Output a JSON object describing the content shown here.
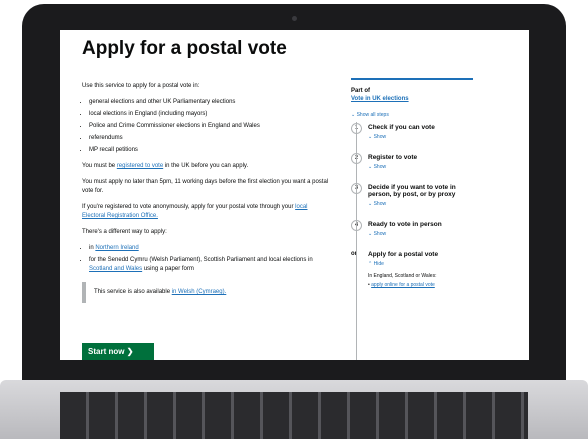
{
  "page": {
    "title": "Apply for a postal vote",
    "intro": "Use this service to apply for a postal vote in:",
    "bullets": [
      "general elections and other UK Parliamentary elections",
      "local elections in England (including mayors)",
      "Police and Crime Commissioner elections in England and Wales",
      "referendums",
      "MP recall petitions"
    ],
    "registered_before": "You must be",
    "registered_link": "registered to vote",
    "registered_after": "in the UK before you can apply.",
    "deadline": "You must apply no later than 5pm, 11 working days before the first election you want a postal vote for.",
    "anon_text": "If you're registered to vote anonymously, apply for your postal vote through your",
    "anon_link": "local Electoral Registration Office.",
    "different_way": "There's a different way to apply:",
    "diff_item1_before": "in",
    "diff_item1_link": "Northern Ireland",
    "diff_item2_before": "for the Senedd Cymru (Welsh Parliament), Scottish Parliament and local elections in",
    "diff_item2_link": "Scotland and Wales",
    "diff_item2_after": "using a paper form",
    "welsh_text": "This service is also available",
    "welsh_link": "in Welsh (Cymraeg).",
    "start_button": "Start now"
  },
  "sidebar": {
    "part_of": "Part of",
    "part_of_link": "Vote in UK elections",
    "show_all": "Show all steps",
    "steps": [
      {
        "num": "1",
        "title": "Check if you can vote",
        "show": "Show"
      },
      {
        "num": "2",
        "title": "Register to vote",
        "show": "Show"
      },
      {
        "num": "3",
        "title": "Decide if you want to vote in person, by post, or by proxy",
        "show": "Show"
      },
      {
        "num": "4",
        "title": "Ready to vote in person",
        "show": "Show"
      }
    ],
    "or_label": "or",
    "final_step_title": "Apply for a postal vote",
    "final_hide": "Hide",
    "final_text": "In England, Scotland or Wales:",
    "final_item": "apply online for a postal vote"
  },
  "colors": {
    "link": "#1d70b8",
    "button": "#00703c",
    "text": "#0b0c0c",
    "frame": "#1b1b1d"
  }
}
